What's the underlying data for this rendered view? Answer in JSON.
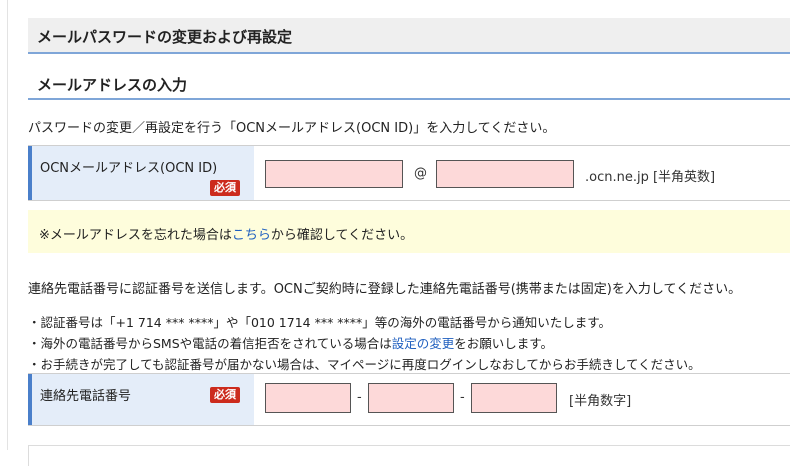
{
  "main_title": "メールパスワードの変更および再設定",
  "section_title": "メールアドレスの入力",
  "intro_text": "パスワードの変更／再設定を行う「OCNメールアドレス(OCN ID)」を入力してください。",
  "email_row": {
    "label": "OCNメールアドレス(OCN ID)",
    "required_badge": "必須",
    "user_value": "",
    "at_symbol": "@",
    "subdomain_value": "",
    "domain_suffix": ".ocn.ne.jp [半角英数]"
  },
  "notice": {
    "prefix": "※メールアドレスを忘れた場合は",
    "link": "こちら",
    "suffix": "から確認してください。"
  },
  "phone_intro": "連絡先電話番号に認証番号を送信します。OCNご契約時に登録した連絡先電話番号(携帯または固定)を入力してください。",
  "bullets": {
    "b1": "・認証番号は「+1 714 *** ****」や「010 1714 *** ****」等の海外の電話番号から通知いたします。",
    "b2_prefix": "・海外の電話番号からSMSや電話の着信拒否をされている場合は",
    "b2_link": "設定の変更",
    "b2_suffix": "をお願いします。",
    "b3": "・お手続きが完了しても認証番号が届かない場合は、マイページに再度ログインしなおしてからお手続きしてください。"
  },
  "phone_row": {
    "label": "連絡先電話番号",
    "required_badge": "必須",
    "part1": "",
    "dash1": "-",
    "part2": "",
    "dash2": "-",
    "part3": "",
    "hint": "[半角数字]"
  },
  "colors": {
    "accent_blue": "#4a7fca",
    "required_red": "#cc2b1d",
    "field_pink": "#fdd9d9",
    "notice_yellow": "#fefddc",
    "link_blue": "#1f5fbf"
  }
}
